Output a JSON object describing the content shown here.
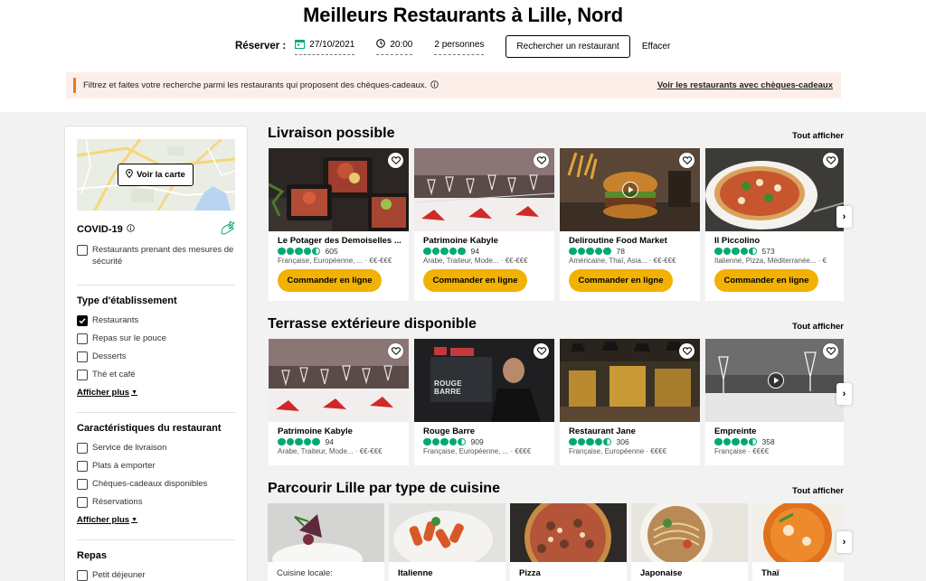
{
  "header": {
    "title": "Meilleurs Restaurants à Lille, Nord",
    "reserve_label": "Réserver :",
    "date": "27/10/2021",
    "time": "20:00",
    "party": "2 personnes",
    "search_btn": "Rechercher un restaurant",
    "clear": "Effacer"
  },
  "banner": {
    "text": "Filtrez et faites votre recherche parmi les restaurants qui proposent des chèques-cadeaux.",
    "link": "Voir les restaurants avec chèques-cadeaux"
  },
  "sidebar": {
    "map_btn": "Voir la carte",
    "covid": {
      "title": "COVID-19",
      "items": [
        {
          "label": "Restaurants prenant des mesures de sécurité",
          "checked": false
        }
      ]
    },
    "type": {
      "title": "Type d'établissement",
      "items": [
        {
          "label": "Restaurants",
          "checked": true
        },
        {
          "label": "Repas sur le pouce",
          "checked": false
        },
        {
          "label": "Desserts",
          "checked": false
        },
        {
          "label": "Thé et café",
          "checked": false
        }
      ],
      "more": "Afficher plus"
    },
    "features": {
      "title": "Caractéristiques du restaurant",
      "items": [
        {
          "label": "Service de livraison",
          "checked": false
        },
        {
          "label": "Plats à emporter",
          "checked": false
        },
        {
          "label": "Chèques-cadeaux disponibles",
          "checked": false
        },
        {
          "label": "Réservations",
          "checked": false
        }
      ],
      "more": "Afficher plus"
    },
    "meals": {
      "title": "Repas",
      "items": [
        {
          "label": "Petit déjeuner",
          "checked": false
        }
      ]
    }
  },
  "delivery": {
    "title": "Livraison possible",
    "see_all": "Tout afficher",
    "order_btn": "Commander en ligne",
    "cards": [
      {
        "name": "Le Potager des Demoiselles ...",
        "rating": 4.5,
        "reviews": "605",
        "meta": "Française, Européenne, ... · €€-€€€"
      },
      {
        "name": "Patrimoine Kabyle",
        "rating": 5,
        "reviews": "94",
        "meta": "Arabe, Traiteur, Mode... · €€-€€€"
      },
      {
        "name": "Deliroutine Food Market",
        "rating": 5,
        "reviews": "78",
        "meta": "Américaine, Thaï, Asia... · €€-€€€"
      },
      {
        "name": "Il Piccolino",
        "rating": 4.5,
        "reviews": "573",
        "meta": "Italienne, Pizza, Méditerranée... · €"
      }
    ]
  },
  "terrace": {
    "title": "Terrasse extérieure disponible",
    "see_all": "Tout afficher",
    "cards": [
      {
        "name": "Patrimoine Kabyle",
        "rating": 5,
        "reviews": "94",
        "meta": "Arabe, Traiteur, Mode... · €€-€€€"
      },
      {
        "name": "Rouge Barre",
        "rating": 4.5,
        "reviews": "909",
        "meta": "Française, Européenne, ... · €€€€"
      },
      {
        "name": "Restaurant Jane",
        "rating": 4.5,
        "reviews": "306",
        "meta": "Française, Européenne · €€€€"
      },
      {
        "name": "Empreinte",
        "rating": 4.5,
        "reviews": "358",
        "meta": "Française · €€€€"
      }
    ],
    "sign_text": "ROUGE BARRE"
  },
  "cuisine": {
    "title": "Parcourir Lille par type de cuisine",
    "see_all": "Tout afficher",
    "items": [
      {
        "label": "Cuisine locale:"
      },
      {
        "label": "Italienne"
      },
      {
        "label": "Pizza"
      },
      {
        "label": "Japonaise"
      },
      {
        "label": "Thaï"
      }
    ]
  },
  "colors": {
    "accent_yellow": "#f2b203",
    "rating_green": "#00aa6c",
    "banner_bg": "#fcefe9",
    "banner_bar": "#e8761d"
  }
}
